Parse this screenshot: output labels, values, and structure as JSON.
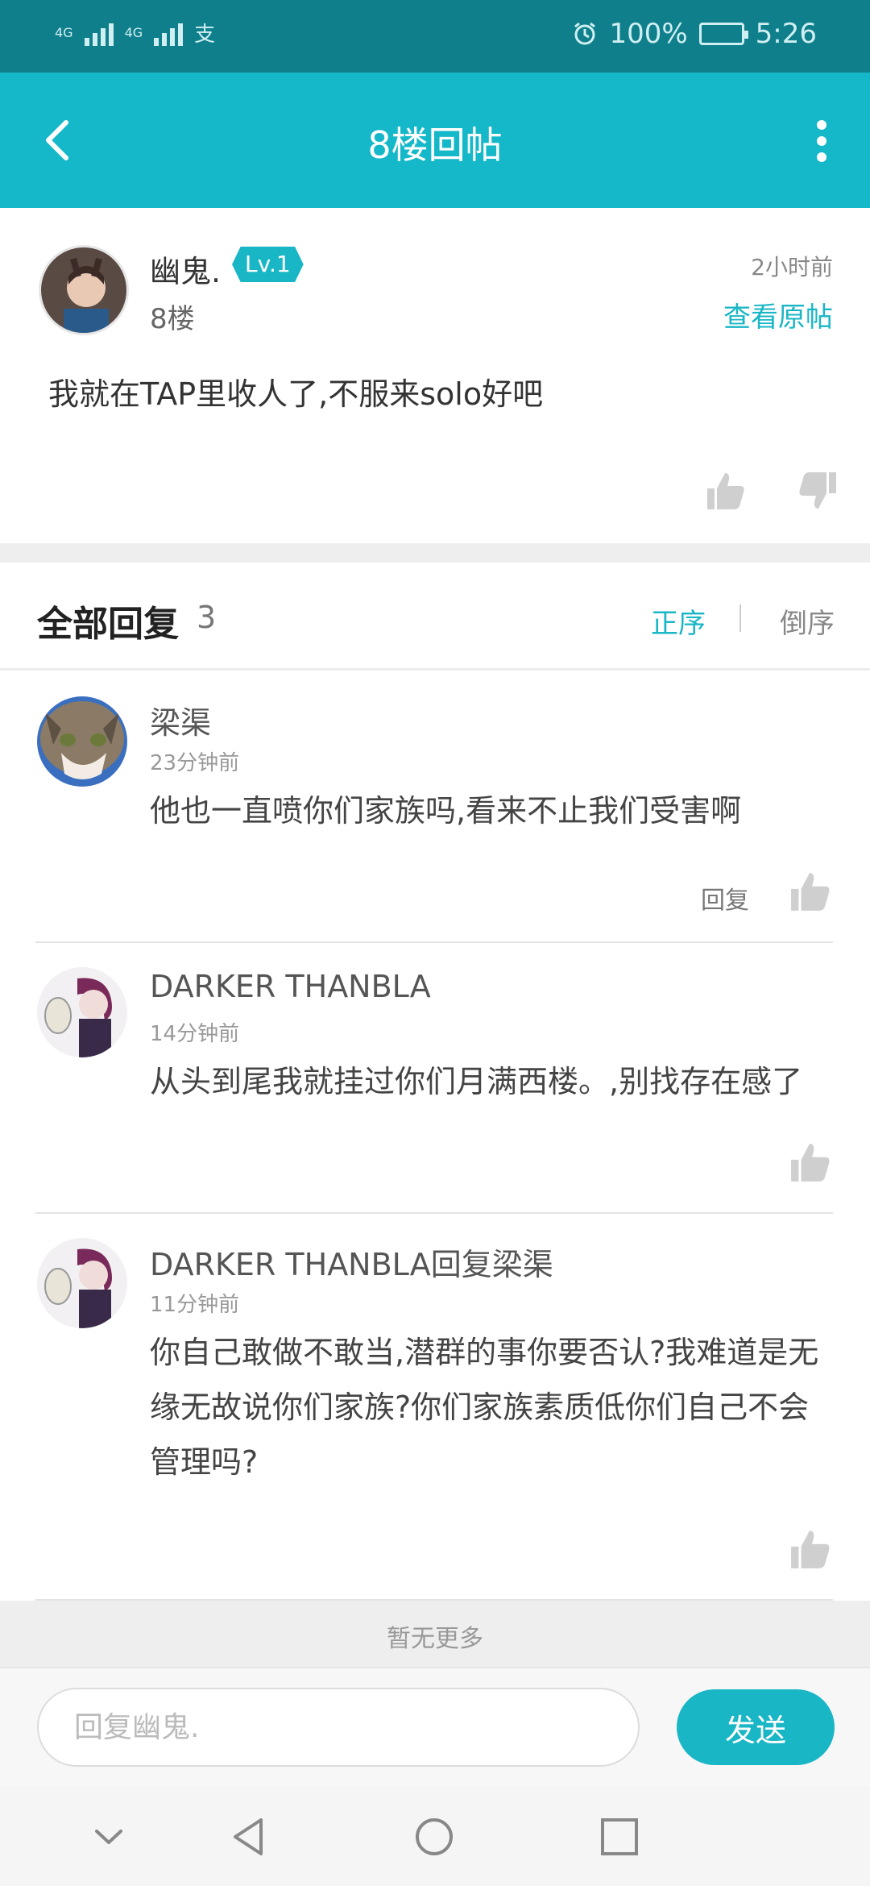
{
  "status_bar": {
    "network1": "4G",
    "network2": "4G",
    "alipay_glyph": "支",
    "battery": "100%",
    "time": "5:26"
  },
  "header": {
    "title": "8楼回帖",
    "back_icon": "chevron-left-icon",
    "more_icon": "more-vertical-icon"
  },
  "post": {
    "author": "幽鬼.",
    "level": "Lv.1",
    "floor": "8楼",
    "time": "2小时前",
    "view_original": "查看原帖",
    "content": "我就在TAP里收人了,不服来solo好吧"
  },
  "replies_header": {
    "label": "全部回复",
    "count": "3",
    "sort_asc": "正序",
    "sort_desc": "倒序"
  },
  "replies": [
    {
      "name": "梁渠",
      "time": "23分钟前",
      "text": "他也一直喷你们家族吗,看来不止我们受害啊",
      "reply_label": "回复"
    },
    {
      "name": "DARKER THANBLA",
      "time": "14分钟前",
      "text": "从头到尾我就挂过你们月满西楼。,别找存在感了"
    },
    {
      "name": "DARKER THANBLA回复梁渠",
      "time": "11分钟前",
      "text": "你自己敢做不敢当,潜群的事你要否认?我难道是无缘无故说你们家族?你们家族素质低你们自己不会管理吗?"
    }
  ],
  "no_more": "暂无更多",
  "input": {
    "placeholder": "回复幽鬼.",
    "send_label": "发送"
  },
  "colors": {
    "status_bar": "#0f7f8b",
    "accent": "#19b6c6",
    "separator": "#eeeeee"
  }
}
